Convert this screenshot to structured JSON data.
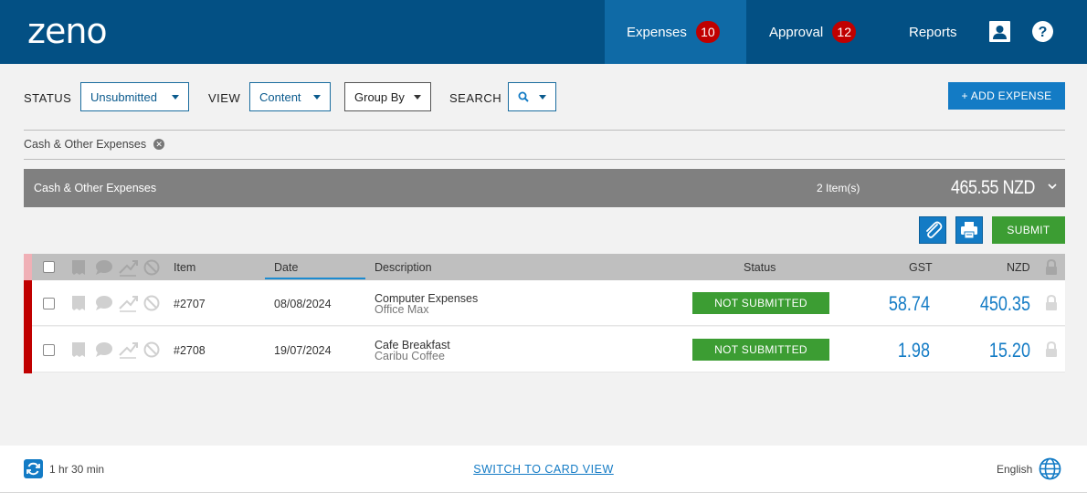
{
  "header": {
    "logo_text": "zeno",
    "nav": [
      {
        "label": "Expenses",
        "badge": "10"
      },
      {
        "label": "Approval",
        "badge": "12"
      },
      {
        "label": "Reports"
      }
    ],
    "icons": [
      "user-icon",
      "help-icon"
    ]
  },
  "filters": {
    "status_label": "STATUS",
    "status_value": "Unsubmitted",
    "view_label": "VIEW",
    "view_value": "Content",
    "group_by": "Group By",
    "search_label": "SEARCH",
    "add_expense": "+ ADD EXPENSE"
  },
  "active_filter_chip": "Cash & Other Expenses",
  "group": {
    "title": "Cash & Other Expenses",
    "count": "2 Item(s)",
    "total": "465.55 NZD"
  },
  "actions": {
    "submit": "SUBMIT",
    "icons": [
      "paperclip-icon",
      "print-icon"
    ]
  },
  "table": {
    "columns": {
      "item": "Item",
      "date": "Date",
      "description": "Description",
      "status": "Status",
      "gst": "GST",
      "nzd": "NZD"
    },
    "rows": [
      {
        "item": "#2707",
        "date": "08/08/2024",
        "description": "Computer Expenses",
        "merchant": "Office Max",
        "status": "NOT SUBMITTED",
        "gst": "58.74",
        "nzd": "450.35"
      },
      {
        "item": "#2708",
        "date": "19/07/2024",
        "description": "Cafe Breakfast",
        "merchant": "Caribu Coffee",
        "status": "NOT SUBMITTED",
        "gst": "1.98",
        "nzd": "15.20"
      }
    ]
  },
  "footer": {
    "session_time": "1 hr 30 min",
    "switch_view": "SWITCH TO CARD VIEW",
    "language": "English"
  },
  "colors": {
    "header_bg": "#035084",
    "accent": "#137bc5",
    "submit_green": "#3c9d33",
    "badge_red": "#c00000"
  }
}
